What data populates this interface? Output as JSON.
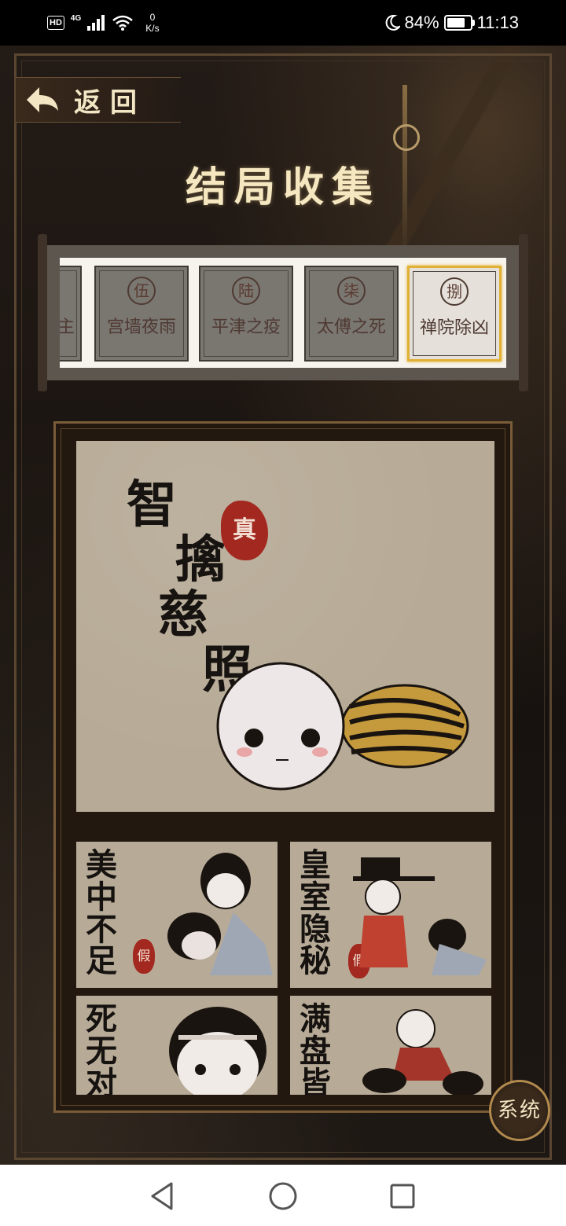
{
  "status_bar": {
    "hd": "HD",
    "network": "4G",
    "speed_value": "0",
    "speed_unit": "K/s",
    "battery": "84%",
    "time": "11:13"
  },
  "header": {
    "back_label": "返回",
    "title": "结局收集"
  },
  "tabs": [
    {
      "seal": "",
      "label": "主",
      "active": false
    },
    {
      "seal": "伍",
      "label": "宫墙夜雨",
      "active": false
    },
    {
      "seal": "陆",
      "label": "平津之疫",
      "active": false
    },
    {
      "seal": "柒",
      "label": "太傅之死",
      "active": false
    },
    {
      "seal": "捌",
      "label": "禅院除凶",
      "active": true
    }
  ],
  "endings": {
    "main": {
      "title": "智擒慈照",
      "seal": "真"
    },
    "cards": [
      {
        "title": "美中不足",
        "seal": "假"
      },
      {
        "title": "皇室隐秘",
        "seal": "假"
      },
      {
        "title": "死无对",
        "seal": ""
      },
      {
        "title": "满盘皆",
        "seal": ""
      }
    ]
  },
  "system_button": "系统",
  "colors": {
    "gold": "#e1b135",
    "seal_red": "#a3281f",
    "paper": "#b7ab97",
    "title_text": "#f5e7bf"
  }
}
